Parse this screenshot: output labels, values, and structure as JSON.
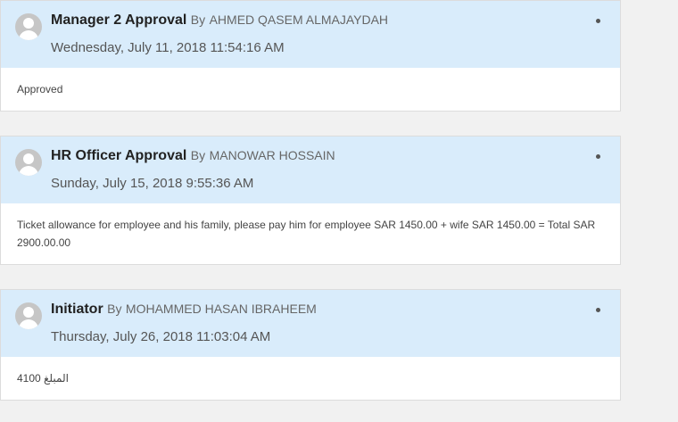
{
  "entries": [
    {
      "step": "Manager 2 Approval",
      "by_label": "By",
      "by_name": "AHMED QASEM ALMAJAYDAH",
      "timestamp": "Wednesday, July 11, 2018 11:54:16 AM",
      "comment": "Approved"
    },
    {
      "step": "HR Officer Approval",
      "by_label": "By",
      "by_name": "MANOWAR HOSSAIN",
      "timestamp": "Sunday, July 15, 2018 9:55:36 AM",
      "comment": "Ticket allowance for employee and his family, please pay him for employee SAR 1450.00 + wife SAR 1450.00 = Total SAR 2900.00.00"
    },
    {
      "step": "Initiator",
      "by_label": "By",
      "by_name": "MOHAMMED HASAN IBRAHEEM",
      "timestamp": "Thursday, July 26, 2018 11:03:04 AM",
      "comment": "المبلغ 4100"
    }
  ],
  "colors": {
    "header_background": "#d9ecfb",
    "page_background": "#f1f1f1"
  }
}
